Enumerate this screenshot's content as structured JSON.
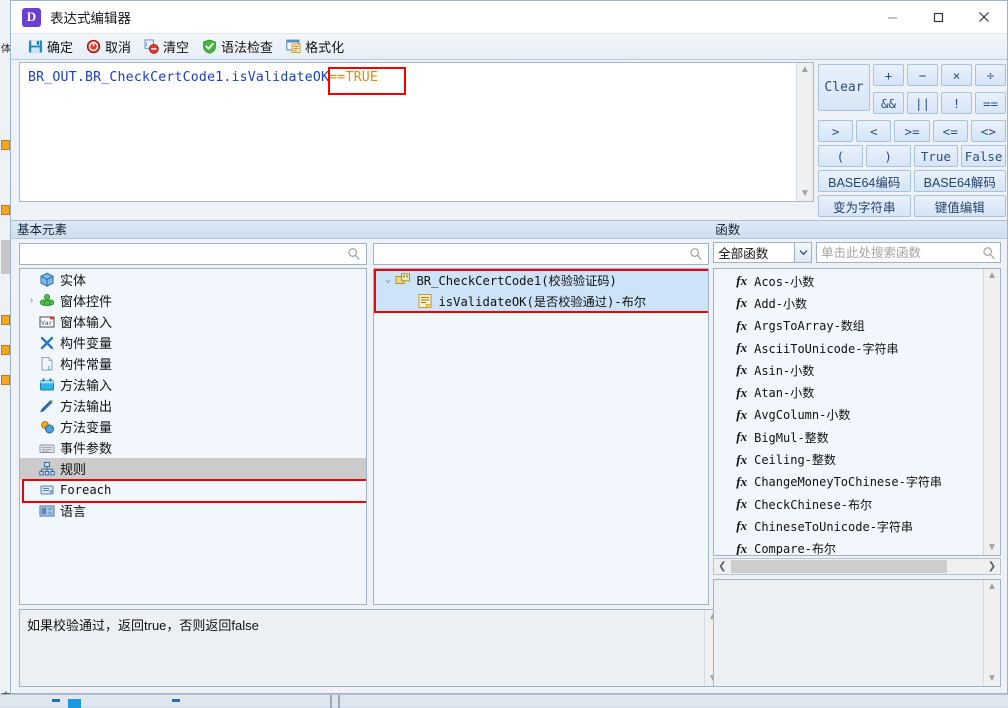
{
  "window": {
    "title": "表达式编辑器",
    "logo_letter": "D",
    "controls": {
      "minimize": "minimize-icon",
      "maximize": "maximize-icon",
      "close": "close-icon"
    }
  },
  "toolbar": {
    "items": [
      {
        "label": "确定",
        "icon": "save-icon"
      },
      {
        "label": "取消",
        "icon": "cancel-icon"
      },
      {
        "label": "清空",
        "icon": "clear-icon"
      },
      {
        "label": "语法检查",
        "icon": "syntax-check-icon"
      },
      {
        "label": "格式化",
        "icon": "format-icon"
      }
    ]
  },
  "expression": {
    "identifier": "BR_OUT.BR_CheckCertCode1.isValidateOK",
    "literal": "==TRUE",
    "full": "BR_OUT.BR_CheckCertCode1.isValidateOK==TRUE",
    "highlight_color": "#f50000"
  },
  "operator_panel": {
    "clear_label": "Clear",
    "row_arith": [
      "+",
      "−",
      "×",
      "÷"
    ],
    "row_logic": [
      "&&",
      "||",
      "!",
      "=="
    ],
    "row_compare": [
      ">",
      "<",
      ">=",
      "<=",
      "<>"
    ],
    "row_paren": [
      "(",
      ")",
      "True",
      "False"
    ],
    "row_base64": [
      "BASE64编码",
      "BASE64解码"
    ],
    "row_convert": [
      "变为字符串",
      "键值编辑"
    ]
  },
  "basic_elements": {
    "group_title": "基本元素",
    "search_value": "",
    "search_placeholder": "",
    "items": [
      {
        "label": "实体",
        "icon": "entity-icon",
        "expander": "",
        "selected": false,
        "mono": false
      },
      {
        "label": "窗体控件",
        "icon": "form-control-icon",
        "expander": "›",
        "selected": false,
        "mono": false
      },
      {
        "label": "窗体输入",
        "icon": "form-input-icon",
        "expander": "",
        "selected": false,
        "mono": false
      },
      {
        "label": "构件变量",
        "icon": "component-variable-icon",
        "expander": "",
        "selected": false,
        "mono": false
      },
      {
        "label": "构件常量",
        "icon": "component-constant-icon",
        "expander": "",
        "selected": false,
        "mono": false
      },
      {
        "label": "方法输入",
        "icon": "method-input-icon",
        "expander": "",
        "selected": false,
        "mono": false
      },
      {
        "label": "方法输出",
        "icon": "method-output-icon",
        "expander": "",
        "selected": false,
        "mono": false
      },
      {
        "label": "方法变量",
        "icon": "method-variable-icon",
        "expander": "",
        "selected": false,
        "mono": false
      },
      {
        "label": "事件参数",
        "icon": "event-param-icon",
        "expander": "",
        "selected": false,
        "mono": false
      },
      {
        "label": "规则",
        "icon": "rule-icon",
        "expander": "",
        "selected": true,
        "mono": false
      },
      {
        "label": "Foreach",
        "icon": "foreach-icon",
        "expander": "",
        "selected": false,
        "mono": true
      },
      {
        "label": "语言",
        "icon": "language-icon",
        "expander": "",
        "selected": false,
        "mono": false
      }
    ]
  },
  "rule_tree": {
    "search_value": "",
    "search_placeholder": "",
    "items": [
      {
        "label": "BR_CheckCertCode1(校验验证码)",
        "icon": "rule-node-icon",
        "expander": "⌄",
        "indent": 0,
        "selected": true
      },
      {
        "label": "isValidateOK(是否校验通过)-布尔",
        "icon": "rule-field-icon",
        "expander": "",
        "indent": 1,
        "selected": true
      }
    ]
  },
  "functions": {
    "group_title": "函数",
    "category_value": "全部函数",
    "search_value": "",
    "search_placeholder": "单击此处搜索函数",
    "items": [
      "Acos-小数",
      "Add-小数",
      "ArgsToArray-数组",
      "AsciiToUnicode-字符串",
      "Asin-小数",
      "Atan-小数",
      "AvgColumn-小数",
      "BigMul-整数",
      "Ceiling-整数",
      "ChangeMoneyToChinese-字符串",
      "CheckChinese-布尔",
      "ChineseToUnicode-字符串",
      "Compare-布尔"
    ]
  },
  "description": {
    "text": "如果校验通过，返回true，否则返回false"
  },
  "function_description": {
    "text": ""
  }
}
